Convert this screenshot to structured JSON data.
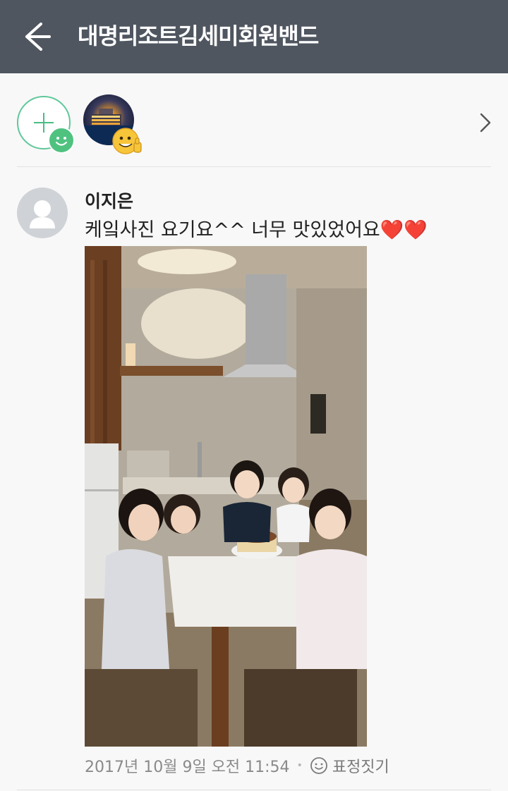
{
  "appbar": {
    "title": "대명리조트김세미회원밴드",
    "background_color": "#4f5660",
    "back_icon": "arrow-left-icon"
  },
  "stickers": {
    "add_icon": "add-sticker-icon",
    "accent_color": "#4fc280",
    "more_icon": "chevron-right-icon"
  },
  "comment": {
    "author": "이지은",
    "text": "케잌사진 요기요^^ 너무 맛있었어요",
    "hearts": "❤️❤️",
    "timestamp": "2017년 10월 9일 오전 11:54",
    "separator": "•",
    "react_label": "표정짓기",
    "react_icon": "smiley-icon"
  }
}
